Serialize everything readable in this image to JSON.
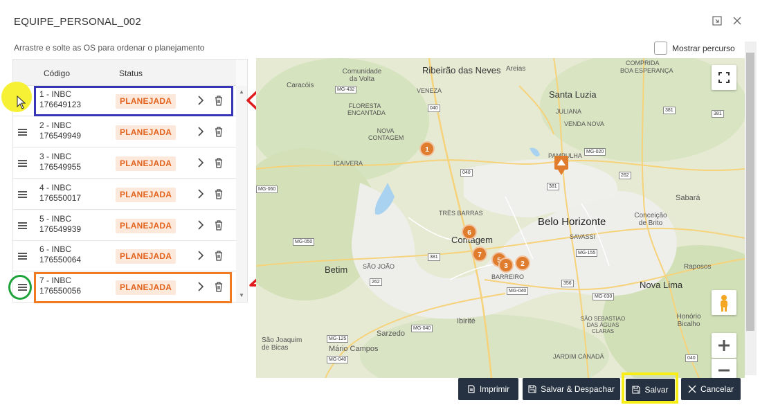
{
  "dialog": {
    "title": "EQUIPE_PERSONAL_002",
    "hint": "Arrastre e solte as OS para ordenar o planejamento",
    "show_route_label": "Mostrar percurso"
  },
  "table": {
    "col_code": "Código",
    "col_status": "Status",
    "rows": [
      {
        "line1": "1 - INBC",
        "line2": "176649123",
        "status": "PLANEJADA"
      },
      {
        "line1": "2 - INBC",
        "line2": "176549949",
        "status": "PLANEJADA"
      },
      {
        "line1": "3 - INBC",
        "line2": "176549955",
        "status": "PLANEJADA"
      },
      {
        "line1": "4 - INBC",
        "line2": "176550017",
        "status": "PLANEJADA"
      },
      {
        "line1": "5 - INBC",
        "line2": "176549939",
        "status": "PLANEJADA"
      },
      {
        "line1": "6 - INBC",
        "line2": "176550064",
        "status": "PLANEJADA"
      },
      {
        "line1": "7 - INBC",
        "line2": "176550056",
        "status": "PLANEJADA"
      }
    ]
  },
  "map": {
    "markers": [
      "1",
      "6",
      "7",
      "5",
      "3",
      "2"
    ],
    "labels": {
      "ribeirao": "Ribeirão das Neves",
      "santa_luzia": "Santa Luzia",
      "bh": "Belo Horizonte",
      "contagem": "Contagem",
      "betim": "Betim",
      "nova_lima": "Nova Lima",
      "sabara": "Sabará",
      "ibirite": "Ibirité",
      "sarzedo": "Sarzedo",
      "mario_campos": "Mário Campos",
      "sao_joaquim": "São Joaquim de Bicas",
      "comunidade": "Comunidade da Volta",
      "floresta": "FLORESTA ENCANTADA",
      "venda_nova": "VENDA NOVA",
      "pampulha": "PAMPULHA",
      "savassi": "SAVASSI",
      "caracois": "Caracóis",
      "areias": "Areias",
      "veneza": "VENEZA",
      "nova_contagem": "NOVA CONTAGEM",
      "icaivera": "ICAIVERA",
      "tres_barras": "TRÊS BARRAS",
      "sao_joao": "SÃO JOÃO",
      "barreiro": "BARREIRO",
      "raposos": "Raposos",
      "honorio": "Honório Bicalho",
      "juliana": "JULIANA",
      "compridna": "COMPRIDA",
      "boa_esperanca": "BOA ESPERANÇA",
      "rio_acima": "SÃO SEBASTIAO DAS ÁGUAS CLARAS",
      "jardim_canada": "JARDIM CANADÁ",
      "conceicao": "Conceição de Brito"
    },
    "road_tags": [
      "MG-432",
      "040",
      "040",
      "MG-020",
      "381",
      "381",
      "262",
      "MG-060",
      "MG-050",
      "MG-040",
      "381",
      "MG-155",
      "356",
      "MG-030",
      "262",
      "MG-040",
      "MG-125",
      "MG-040",
      "040",
      "381"
    ]
  },
  "buttons": {
    "print": "Imprimir",
    "save_dispatch": "Salvar & Despachar",
    "save": "Salvar",
    "cancel": "Cancelar"
  },
  "colors": {
    "accent_button": "#263241",
    "status_text": "#e2641e",
    "status_bg": "#fde9dc",
    "marker": "#e07c2e",
    "highlight_blue": "#3535b5",
    "highlight_orange": "#f07b22",
    "highlight_yellow": "#f7ee16",
    "highlight_green": "#1ea33b",
    "arrow_red": "#e01b1b"
  }
}
